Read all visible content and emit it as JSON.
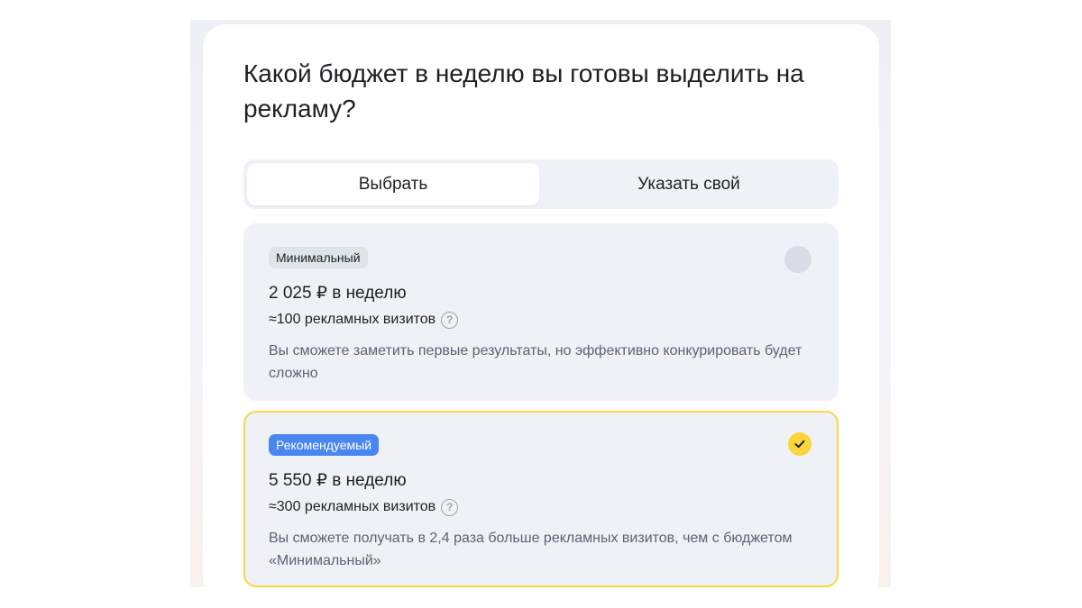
{
  "title": "Какой бюджет в неделю вы готовы выделить на рекламу?",
  "switcher": {
    "tabs": [
      {
        "label": "Выбрать",
        "active": true
      },
      {
        "label": "Указать свой",
        "active": false
      }
    ]
  },
  "options": [
    {
      "badge": "Минимальный",
      "price": "2 025 ₽ в неделю",
      "visits": "≈100 рекламных визитов",
      "description": "Вы сможете заметить первые результаты, но эффективно конкурировать будет сложно",
      "selected": false
    },
    {
      "badge": "Рекомендуемый",
      "price": "5 550 ₽ в неделю",
      "visits": "≈300 рекламных визитов",
      "description": "Вы сможете получать в 2,4 раза больше рекламных визитов, чем с бюджетом «Минимальный»",
      "selected": true
    }
  ],
  "icons": {
    "help": "question-circle-icon",
    "selected": "checkmark-icon"
  },
  "colors": {
    "accent_yellow": "#fbd53a",
    "selected_border": "#f7d848",
    "badge_blue": "#4a86f0",
    "card_bg": "#eef1f6"
  }
}
